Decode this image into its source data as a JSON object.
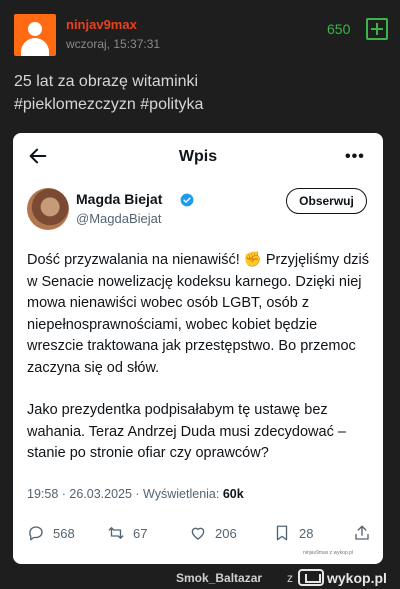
{
  "post": {
    "username": "ninjav9max",
    "timestamp": "wczoraj, 15:37:31",
    "votes": "650",
    "text": "25 lat za obrazę witaminki",
    "tags": "#pieklomezczyzn #polityka"
  },
  "tweet": {
    "header_title": "Wpis",
    "author_name": "Magda Biejat",
    "author_handle": "@MagdaBiejat",
    "follow_label": "Obserwuj",
    "paragraph1": "Dość przyzwalania na nienawiść! ✊ Przyjęliśmy dziś w Senacie nowelizację kodeksu karnego. Dzięki niej mowa nienawiści wobec osób LGBT, osób z niepełnosprawnościami, wobec kobiet będzie wreszcie traktowana jak przestępstwo. Bo przemoc zaczyna się od słów.",
    "paragraph2": "Jako prezydentka podpisałabym tę ustawę bez wahania. Teraz Andrzej Duda musi zdecydować – stanie po stronie ofiar czy oprawców?",
    "meta_datetime": "19:58 · 26.03.2025 · Wyświetlenia: ",
    "meta_views": "60k",
    "replies": "568",
    "retweets": "67",
    "likes": "206",
    "bookmarks": "28",
    "watermark": "ninjav9max z wykop.pl"
  },
  "footer": {
    "author": "Smok_Baltazar",
    "z": "z",
    "logo_text": "wykop.pl"
  },
  "colors": {
    "background": "#1e1e1e",
    "username": "#e8411f",
    "votes": "#3bb44a",
    "avatar": "#ff6a13",
    "verified": "#1d9bf0"
  }
}
